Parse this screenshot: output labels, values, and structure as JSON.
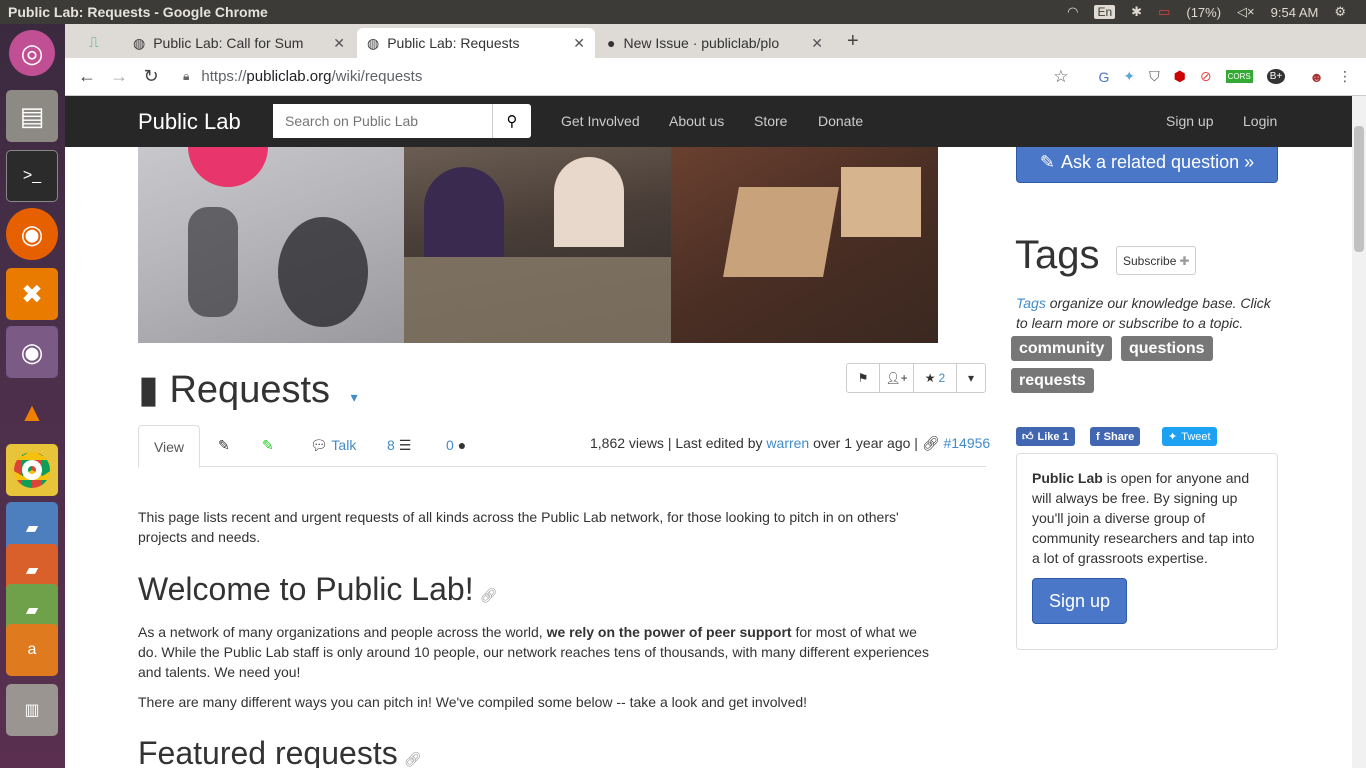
{
  "os": {
    "window_title": "Public Lab: Requests - Google Chrome",
    "lang": "En",
    "battery": "(17%)",
    "time": "9:54 AM"
  },
  "browser": {
    "tabs": [
      {
        "label": "Public Lab: Call for Sum"
      },
      {
        "label": "Public Lab: Requests"
      },
      {
        "label": "New Issue · publiclab/plo"
      }
    ],
    "url_prefix": "https://",
    "url_host": "publiclab.org",
    "url_path": "/wiki/requests"
  },
  "navbar": {
    "brand": "Public Lab",
    "search_placeholder": "Search on Public Lab",
    "links": [
      "Get Involved",
      "About us",
      "Store",
      "Donate"
    ],
    "signup": "Sign up",
    "login": "Login"
  },
  "page": {
    "title": "Requests",
    "star_count": "2",
    "tabs": {
      "view": "View",
      "talk": "Talk",
      "revisions": "8",
      "comments": "0"
    },
    "meta": {
      "views": "1,862 views | Last edited by ",
      "editor": "warren",
      "ago": " over 1 year ago | ",
      "id": "#14956"
    },
    "intro": "This page lists recent and urgent requests of all kinds across the Public Lab network, for those looking to pitch in on others' projects and needs.",
    "welcome_heading": "Welcome to Public Lab!",
    "welcome_p1_a": "As a network of many organizations and people across the world, ",
    "welcome_p1_bold": "we rely on the power of peer support",
    "welcome_p1_b": " for most of what we do. While the Public Lab staff is only around 10 people, our network reaches tens of thousands, with many different experiences and talents. We need you!",
    "welcome_p2": "There are many different ways you can pitch in! We've compiled some below -- take a look and get involved!",
    "featured_heading": "Featured requests"
  },
  "sidebar": {
    "ask_button": "Ask a related question »",
    "tags_heading": "Tags",
    "subscribe": "Subscribe",
    "tags_link": "Tags",
    "tags_text": " organize our knowledge base. Click to learn more or subscribe to a topic.",
    "tags": [
      "community",
      "questions",
      "requests"
    ],
    "social": {
      "like": "Like 1",
      "share": "Share",
      "tweet": "Tweet"
    },
    "signup_bold": "Public Lab",
    "signup_text": " is open for anyone and will always be free. By signing up you'll join a diverse group of community researchers and tap into a lot of grassroots expertise.",
    "signup_button": "Sign up"
  },
  "colors": {
    "brand_blue": "#4a77c8",
    "navbar": "#272727",
    "tag": "#777777",
    "launcher": "#4a2f4a"
  }
}
